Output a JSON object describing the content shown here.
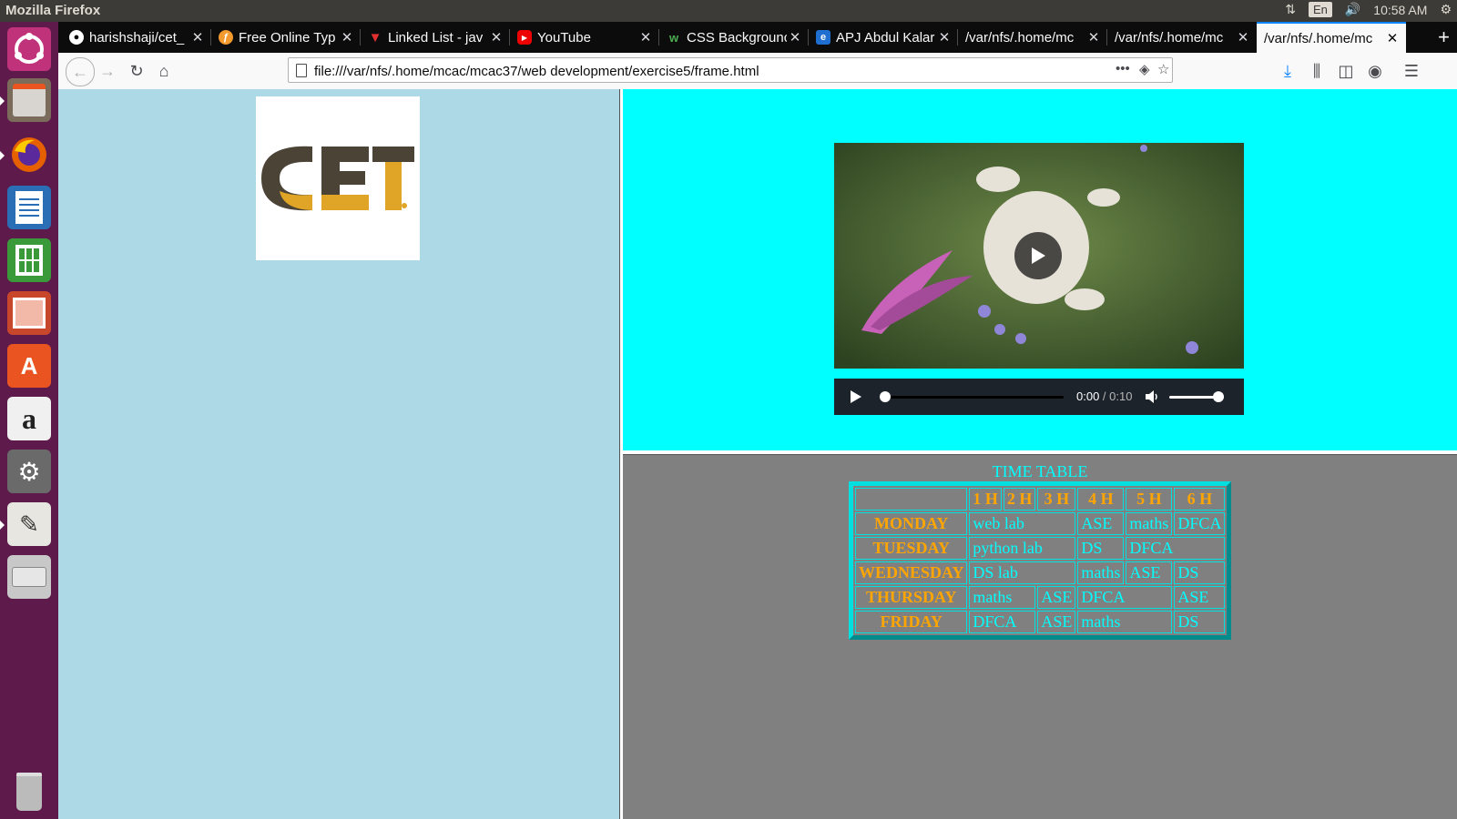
{
  "os": {
    "window_title": "Mozilla Firefox",
    "keyboard_layout": "En",
    "clock": "10:58 AM"
  },
  "tabs": [
    {
      "label": "harishshaji/cet_",
      "icon": "github-icon",
      "active": false
    },
    {
      "label": "Free Online Typ",
      "icon": "typing-icon",
      "active": false
    },
    {
      "label": "Linked List - jav",
      "icon": "v-logo-icon",
      "active": false
    },
    {
      "label": "YouTube",
      "icon": "youtube-icon",
      "active": false
    },
    {
      "label": "CSS Backgrounc",
      "icon": "w3schools-icon",
      "active": false
    },
    {
      "label": "APJ Abdul Kalar",
      "icon": "edge-icon",
      "active": false
    },
    {
      "label": "/var/nfs/.home/mc",
      "icon": "",
      "active": false
    },
    {
      "label": "/var/nfs/.home/mc",
      "icon": "",
      "active": false
    },
    {
      "label": "/var/nfs/.home/mc",
      "icon": "",
      "active": true
    }
  ],
  "navbar": {
    "url": "file:///var/nfs/.home/mcac/mcac37/web development/exercise5/frame.html"
  },
  "logo": {
    "text": "CET"
  },
  "video": {
    "current_time": "0:00",
    "separator": " / ",
    "duration": "0:10",
    "progress": 0.0,
    "volume": 1.0
  },
  "timetable": {
    "caption": "TIME TABLE",
    "headers": [
      "",
      "1 H",
      "2 H",
      "3 H",
      "4 H",
      "5 H",
      "6 H"
    ],
    "rows": [
      {
        "day": "MONDAY",
        "cells": [
          {
            "text": "web lab",
            "span": 3
          },
          {
            "text": "ASE",
            "span": 1
          },
          {
            "text": "maths",
            "span": 1
          },
          {
            "text": "DFCA",
            "span": 1
          }
        ]
      },
      {
        "day": "TUESDAY",
        "cells": [
          {
            "text": "python lab",
            "span": 3
          },
          {
            "text": "DS",
            "span": 1
          },
          {
            "text": "DFCA",
            "span": 2
          }
        ]
      },
      {
        "day": "WEDNESDAY",
        "cells": [
          {
            "text": "DS lab",
            "span": 3
          },
          {
            "text": "maths",
            "span": 1
          },
          {
            "text": "ASE",
            "span": 1
          },
          {
            "text": "DS",
            "span": 1
          }
        ]
      },
      {
        "day": "THURSDAY",
        "cells": [
          {
            "text": "maths",
            "span": 2
          },
          {
            "text": "ASE",
            "span": 1
          },
          {
            "text": "DFCA",
            "span": 2
          },
          {
            "text": "ASE",
            "span": 1
          }
        ]
      },
      {
        "day": "FRIDAY",
        "cells": [
          {
            "text": "DFCA",
            "span": 2
          },
          {
            "text": "ASE",
            "span": 1
          },
          {
            "text": "maths",
            "span": 2
          },
          {
            "text": "DS",
            "span": 1
          }
        ]
      }
    ]
  },
  "colors": {
    "left_frame_bg": "#add8e6",
    "top_frame_bg": "#00ffff",
    "bottom_frame_bg": "#808080",
    "table_header_text": "#ffa500",
    "table_cell_text": "#00ffff"
  }
}
